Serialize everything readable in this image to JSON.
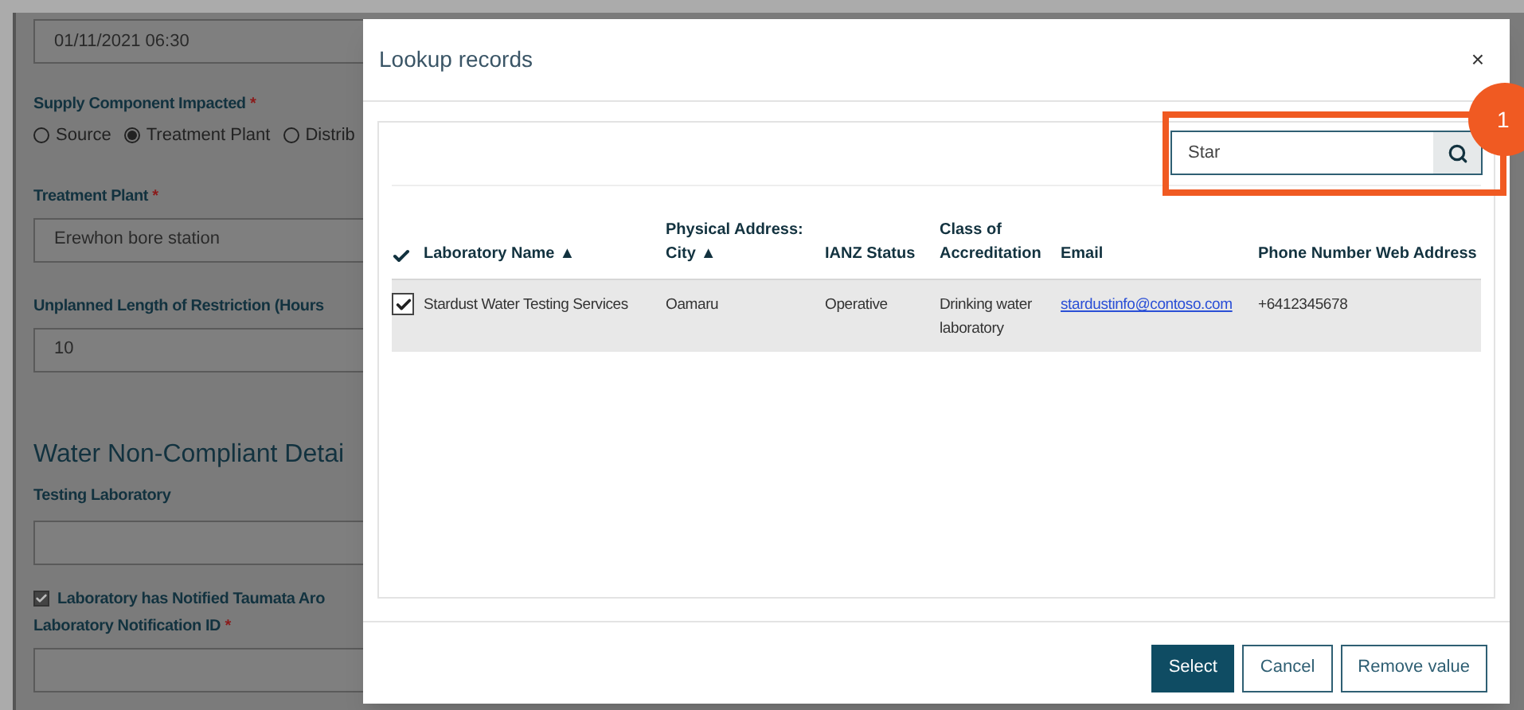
{
  "form": {
    "date_value": "01/11/2021 06:30",
    "supply_label": "Supply Component Impacted",
    "supply_options": [
      {
        "label": "Source",
        "selected": false
      },
      {
        "label": "Treatment Plant",
        "selected": true
      },
      {
        "label": "Distrib",
        "selected": false
      }
    ],
    "plant_label": "Treatment Plant",
    "plant_value": "Erewhon bore station",
    "length_label": "Unplanned Length of Restriction (Hours",
    "length_value": "10",
    "section_title": "Water Non-Compliant Detai",
    "lab_label": "Testing Laboratory",
    "notified": {
      "label": "Laboratory has Notified Taumata Aro",
      "checked": true
    },
    "notification_label": "Laboratory Notification ID",
    "required_mark": "*"
  },
  "dialog": {
    "title": "Lookup records",
    "close": "×",
    "search": {
      "value": "Star"
    },
    "badge": "1",
    "table": {
      "columns": [
        {
          "label": "Laboratory Name",
          "sort": "▲"
        },
        {
          "label": "Physical Address: City",
          "sort": "▲"
        },
        {
          "label": "IANZ Status"
        },
        {
          "label": "Class of Accreditation"
        },
        {
          "label": "Email"
        },
        {
          "label": "Phone Number"
        },
        {
          "label": "Web Address"
        }
      ],
      "rows": [
        {
          "selected": true,
          "cells": [
            "Stardust Water Testing Services",
            "Oamaru",
            "Operative",
            "Drinking water laboratory",
            "stardustinfo@contoso.com",
            "+6412345678",
            ""
          ]
        }
      ]
    },
    "buttons": [
      {
        "label": "Select",
        "kind": "primary"
      },
      {
        "label": "Cancel",
        "kind": "secondary"
      },
      {
        "label": "Remove value",
        "kind": "secondary"
      }
    ]
  }
}
